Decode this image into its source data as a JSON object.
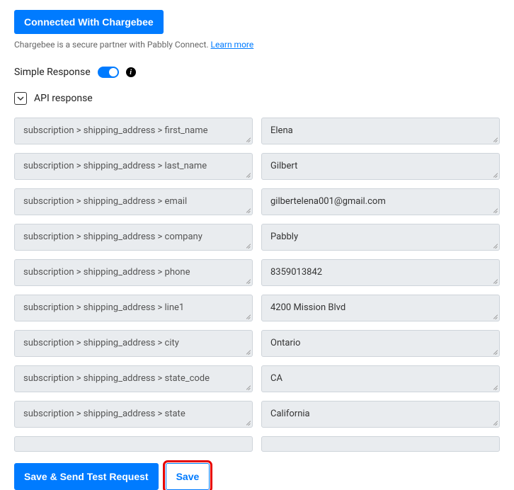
{
  "header": {
    "connected_label": "Connected With Chargebee",
    "partner_note_prefix": "Chargebee is a secure partner with Pabbly Connect. ",
    "learn_more_label": "Learn more"
  },
  "simple_response": {
    "label": "Simple Response"
  },
  "api_response": {
    "label": "API response",
    "fields": [
      {
        "key": "subscription > shipping_address > first_name",
        "value": "Elena"
      },
      {
        "key": "subscription > shipping_address > last_name",
        "value": "Gilbert"
      },
      {
        "key": "subscription > shipping_address > email",
        "value": "gilbertelena001@gmail.com"
      },
      {
        "key": "subscription > shipping_address > company",
        "value": "Pabbly"
      },
      {
        "key": "subscription > shipping_address > phone",
        "value": "8359013842"
      },
      {
        "key": "subscription > shipping_address > line1",
        "value": "4200 Mission Blvd"
      },
      {
        "key": "subscription > shipping_address > city",
        "value": "Ontario"
      },
      {
        "key": "subscription > shipping_address > state_code",
        "value": "CA"
      },
      {
        "key": "subscription > shipping_address > state",
        "value": "California"
      }
    ]
  },
  "actions": {
    "save_send_label": "Save & Send Test Request",
    "save_label": "Save"
  }
}
